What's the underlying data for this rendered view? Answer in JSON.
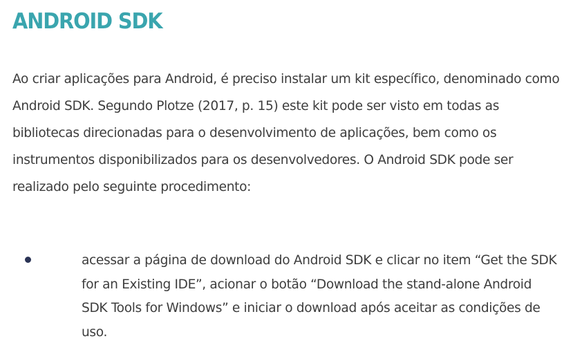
{
  "section": {
    "title": "ANDROID SDK",
    "intro_paragraph": "Ao criar aplicações para Android, é preciso instalar um kit específico, denominado como Android SDK. Segundo Plotze (2017, p. 15) este kit pode ser visto em todas as bibliotecas direcionadas para o desenvolvimento de aplicações, bem como os instrumentos disponibilizados para os desenvolvedores. O Android SDK pode ser realizado pelo seguinte procedimento:",
    "steps": [
      {
        "text": "acessar a página de download do Android SDK e clicar no item “Get the SDK for an Existing IDE”, acionar o botão “Download the stand-alone Android SDK Tools for Windows” e iniciar o download após aceitar as condições de uso."
      }
    ]
  },
  "colors": {
    "heading": "#3aa5ae",
    "body_text": "#3d3d3d",
    "bullet": "#2a3355",
    "background": "#ffffff"
  }
}
